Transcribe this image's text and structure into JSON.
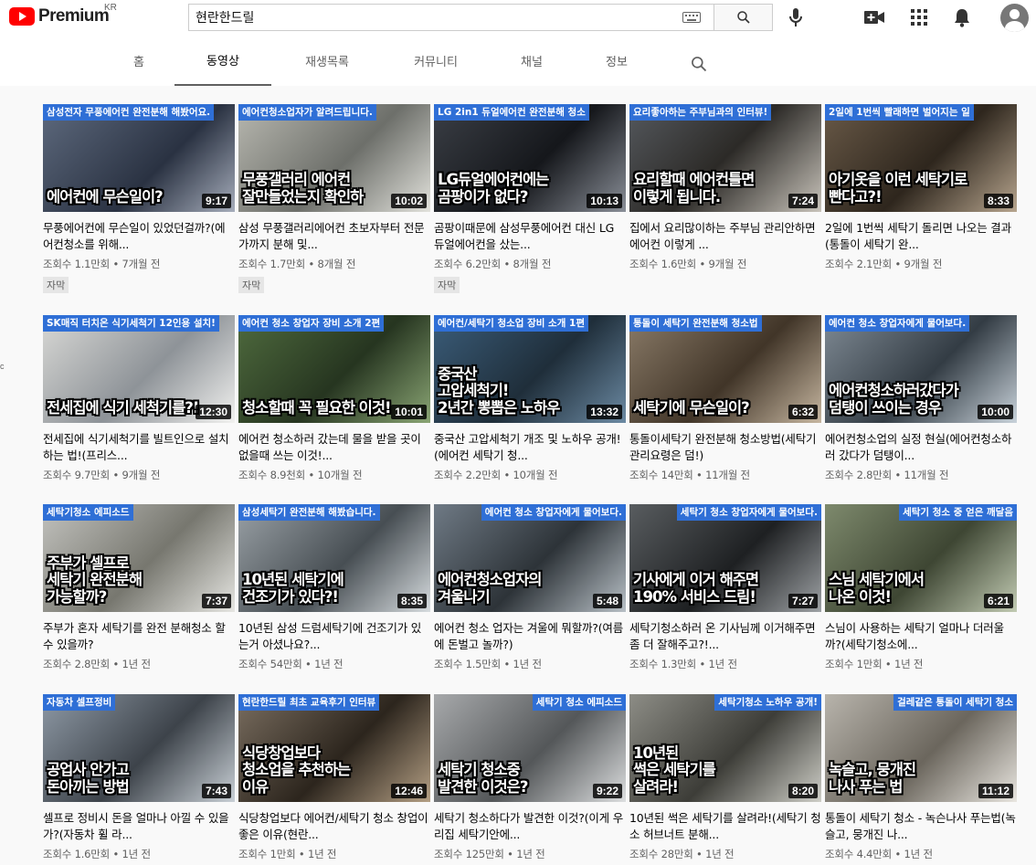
{
  "masthead": {
    "logo_text": "Premium",
    "region": "KR",
    "search_value": "현란한드릴",
    "search_placeholder": "검색",
    "icons": [
      "keyboard-icon",
      "search-icon",
      "mic-icon",
      "create-video-icon",
      "apps-icon",
      "notifications-icon",
      "avatar"
    ]
  },
  "tabs": [
    {
      "label": "홈",
      "selected": false
    },
    {
      "label": "동영상",
      "selected": true
    },
    {
      "label": "재생목록",
      "selected": false
    },
    {
      "label": "커뮤니티",
      "selected": false
    },
    {
      "label": "채널",
      "selected": false
    },
    {
      "label": "정보",
      "selected": false
    }
  ],
  "side_mark": "c",
  "videos": [
    {
      "banner": "삼성전자 무풍에어컨 완전분해 해봤어요.",
      "big": "에어컨에 무슨일이?",
      "duration": "9:17",
      "title": "무풍에어컨에 무슨일이 있었던걸까?(에어컨청소를 위해...",
      "meta": "조회수 1.1만회 • 7개월 전",
      "badge": "자막"
    },
    {
      "banner": "에어컨청소업자가 알려드립니다.",
      "big": "무풍갤러리 에어컨\n잘만들었는지 확인하",
      "duration": "10:02",
      "title": "삼성 무풍갤러리에어컨 초보자부터 전문가까지 분해 및...",
      "meta": "조회수 1.7만회 • 8개월 전",
      "badge": "자막"
    },
    {
      "banner": "LG 2in1 듀얼에어컨 완전분해 청소",
      "big": "LG듀얼에어컨에는\n곰팡이가 없다?",
      "duration": "10:13",
      "title": "곰팡이때문에 삼성무풍에어컨 대신 LG 듀얼에어컨을 샀는...",
      "meta": "조회수 6.2만회 • 8개월 전",
      "badge": "자막"
    },
    {
      "banner": "요리좋아하는 주부님과의 인터뷰!",
      "big": "요리할때 에어컨틀면\n이렇게 됩니다.",
      "duration": "7:24",
      "title": "집에서 요리많이하는 주부님 관리안하면 에어컨 이렇게 ...",
      "meta": "조회수 1.6만회 • 9개월 전",
      "badge": ""
    },
    {
      "banner": "2일에 1번씩 빨래하면 벌어지는 일",
      "big": "아기옷을 이런 세탁기로\n빤다고?!",
      "duration": "8:33",
      "title": "2일에 1번씩 세탁기 돌리면 나오는 결과(통돌이 세탁기 완...",
      "meta": "조회수 2.1만회 • 9개월 전",
      "badge": ""
    },
    {
      "banner": "SK매직 터치온 식기세척기 12인용 설치!",
      "big": "전세집에 식기 세척기를?!",
      "duration": "12:30",
      "title": "전세집에 식기세척기를 빌트인으로 설치하는 법!(프리스...",
      "meta": "조회수 9.7만회 • 9개월 전",
      "badge": ""
    },
    {
      "banner": "에어컨 청소 창업자 장비 소개 2편",
      "big": "청소할때 꼭 필요한 이것!",
      "duration": "10:01",
      "title": "에어컨 청소하러 갔는데 물을 받을 곳이 없을때 쓰는 이것!...",
      "meta": "조회수 8.9천회 • 10개월 전",
      "badge": ""
    },
    {
      "banner": "에어컨/세탁기 청소업 장비 소개 1편",
      "big": "중국산\n고압세척기!\n2년간 뽕뽑은 노하우",
      "duration": "13:32",
      "title": "중국산 고압세척기 개조 및 노하우 공개!(에어컨 세탁기 청...",
      "meta": "조회수 2.2만회 • 10개월 전",
      "badge": ""
    },
    {
      "banner": "통돌이 세탁기 완전분해 청소법",
      "big": "세탁기에 무슨일이?",
      "duration": "6:32",
      "title": "통돌이세탁기 완전분해 청소방법(세탁기 관리요령은 덤!)",
      "meta": "조회수 14만회 • 11개월 전",
      "badge": ""
    },
    {
      "banner": "에어컨 청소 창업자에게 물어보다.",
      "big": "에어컨청소하러갔다가\n덤탱이 쓰이는 경우",
      "duration": "10:00",
      "title": "에어컨청소업의 실정 현실(에어컨청소하러 갔다가 덤탱이...",
      "meta": "조회수 2.8만회 • 11개월 전",
      "badge": ""
    },
    {
      "banner": "세탁기청소 에피소드",
      "big": "주부가 셀프로\n세탁기 완전분해\n가능할까?",
      "duration": "7:37",
      "title": "주부가 혼자 세탁기를 완전 분해청소 할 수 있을까?",
      "meta": "조회수 2.8만회 • 1년 전",
      "badge": ""
    },
    {
      "banner": "삼성세탁기 완전분해 해봤습니다.",
      "big": "10년된 세탁기에\n건조기가 있다?!",
      "duration": "8:35",
      "title": "10년된 삼성 드럼세탁기에 건조기가 있는거 아셨나요?...",
      "meta": "조회수 54만회 • 1년 전",
      "badge": ""
    },
    {
      "banner": "에어컨 청소 창업자에게 물어보다.",
      "big": "에어컨청소업자의\n겨울나기",
      "duration": "5:48",
      "title": "에어컨 청소 업자는 겨울에 뭐할까?(여름에 돈벌고 놀까?)",
      "meta": "조회수 1.5만회 • 1년 전",
      "badge": ""
    },
    {
      "banner": "세탁기 청소 창업자에게 물어보다.",
      "big": "기사에게 이거 해주면\n190% 서비스 드림!",
      "duration": "7:27",
      "title": "세탁기청소하러 온 기사님께 이거해주면 좀 더 잘해주고?!...",
      "meta": "조회수 1.3만회 • 1년 전",
      "badge": ""
    },
    {
      "banner": "세탁기 청소 중 얻은 깨달음",
      "big": "스님 세탁기에서\n나온 이것!",
      "duration": "6:21",
      "title": "스님이 사용하는 세탁기 얼마나 더러울까?(세탁기청소에...",
      "meta": "조회수 1만회 • 1년 전",
      "badge": ""
    },
    {
      "banner": "자동차 셀프정비",
      "big": "공업사 안가고\n돈아끼는 방법",
      "duration": "7:43",
      "title": "셀프로 정비시 돈을 얼마나 아낄 수 있을가?(자동차 휠 라...",
      "meta": "조회수 1.6만회 • 1년 전",
      "badge": ""
    },
    {
      "banner": "현란한드릴 최초 교육후기 인터뷰",
      "big": "식당창업보다\n청소업을 추천하는\n이유",
      "duration": "12:46",
      "title": "식당창업보다 에어컨/세탁기 청소 창업이 좋은 이유(현란...",
      "meta": "조회수 1만회 • 1년 전",
      "badge": ""
    },
    {
      "banner": "세탁기 청소 에피소드",
      "big": "세탁기 청소중\n발견한 이것은?",
      "duration": "9:22",
      "title": "세탁기 청소하다가 발견한 이것?(이게 우리집 세탁기안에...",
      "meta": "조회수 125만회 • 1년 전",
      "badge": ""
    },
    {
      "banner": "세탁기청소 노하우 공개!",
      "big": "10년된\n썩은 세탁기를\n살려라!",
      "duration": "8:20",
      "title": "10년된 썩은 세탁기를 살려라!(세탁기 청소 허브너트 분해...",
      "meta": "조회수 28만회 • 1년 전",
      "badge": ""
    },
    {
      "banner": "걸레같은 통돌이 세탁기 청소",
      "big": "녹슬고, 뭉개진\n나사 푸는 법",
      "duration": "11:12",
      "title": "통돌이 세탁기 청소 - 녹슨나사 푸는법(녹슬고, 뭉개진 나...",
      "meta": "조회수 4.4만회 • 1년 전",
      "badge": ""
    }
  ]
}
